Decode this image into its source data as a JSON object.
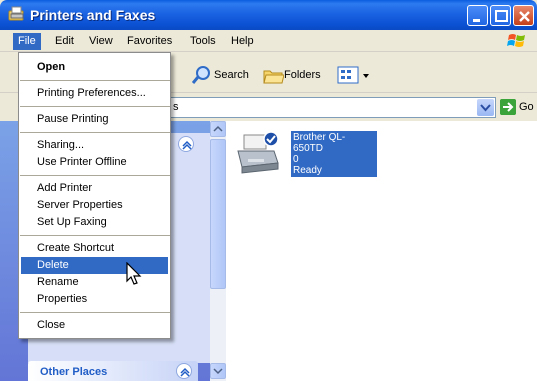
{
  "window": {
    "title": "Printers and Faxes"
  },
  "menubar": [
    "File",
    "Edit",
    "View",
    "Favorites",
    "Tools",
    "Help"
  ],
  "toolbar": {
    "search_label": "Search",
    "folders_label": "Folders"
  },
  "address": {
    "value": "s",
    "go_label": "Go"
  },
  "file_menu": [
    {
      "label": "Open"
    },
    {
      "label": "Printing Preferences..."
    },
    {
      "label": "Pause Printing"
    },
    {
      "label": "Sharing..."
    },
    {
      "label": "Use Printer Offline"
    },
    {
      "label": "Add Printer"
    },
    {
      "label": "Server Properties"
    },
    {
      "label": "Set Up Faxing"
    },
    {
      "label": "Create Shortcut"
    },
    {
      "label": "Delete"
    },
    {
      "label": "Rename"
    },
    {
      "label": "Properties"
    },
    {
      "label": "Close"
    }
  ],
  "taskpane": {
    "other_places_label": "Other Places"
  },
  "printer": {
    "name": "Brother QL-650TD",
    "jobs": "0",
    "status": "Ready"
  },
  "colors": {
    "titlebar": "#0a5ddf",
    "highlight": "#316ac5",
    "taskpane": "#7ba2e7"
  }
}
